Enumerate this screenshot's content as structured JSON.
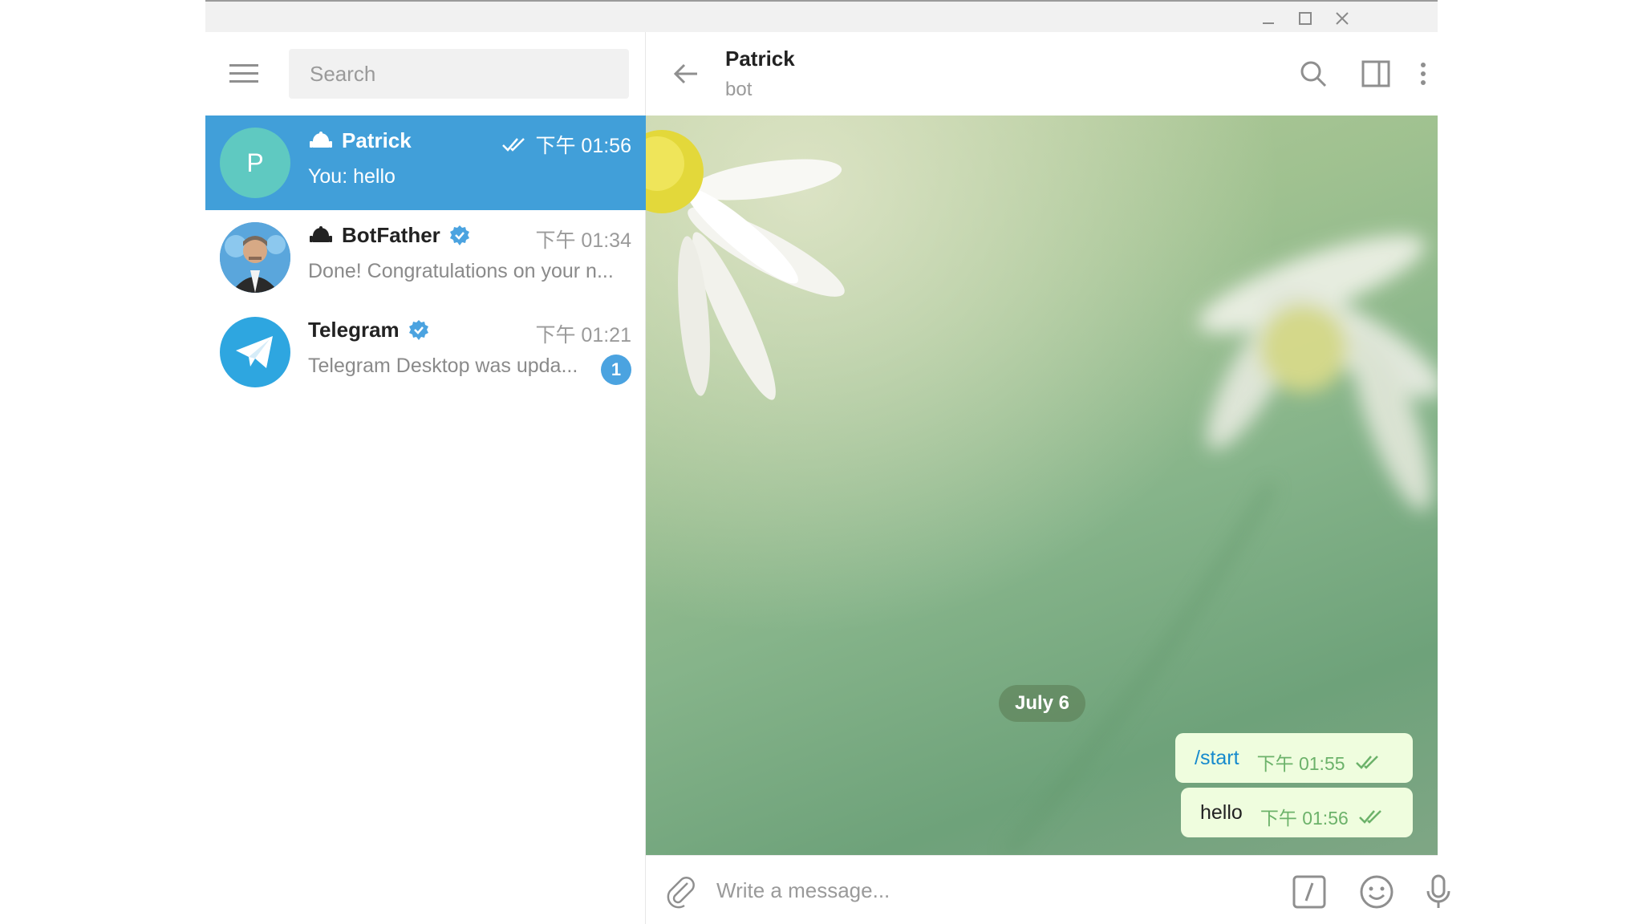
{
  "search": {
    "placeholder": "Search"
  },
  "chats": [
    {
      "name": "Patrick",
      "avatar_letter": "P",
      "avatar_color": "#5fc9c1",
      "time": "下午 01:56",
      "preview": "You: hello",
      "is_bot": true,
      "verified": false,
      "read_check": true,
      "active": true
    },
    {
      "name": "BotFather",
      "time": "下午 01:34",
      "preview": "Done! Congratulations on your n...",
      "is_bot": true,
      "verified": true
    },
    {
      "name": "Telegram",
      "avatar_color": "#2ea6e0",
      "time": "下午 01:21",
      "preview": "Telegram Desktop was upda...",
      "verified": true,
      "unread": "1"
    }
  ],
  "header": {
    "peer_name": "Patrick",
    "peer_status": "bot"
  },
  "conversation": {
    "date_label": "July 6",
    "messages": [
      {
        "text": "/start",
        "time": "下午 01:55",
        "type": "command"
      },
      {
        "text": "hello",
        "time": "下午 01:56",
        "type": "text"
      }
    ]
  },
  "composer": {
    "placeholder": "Write a message..."
  },
  "colors": {
    "accent": "#419fd9",
    "bubble_out": "#effdde",
    "check_green": "#6cb26a",
    "verified_blue": "#4ba3e0"
  }
}
